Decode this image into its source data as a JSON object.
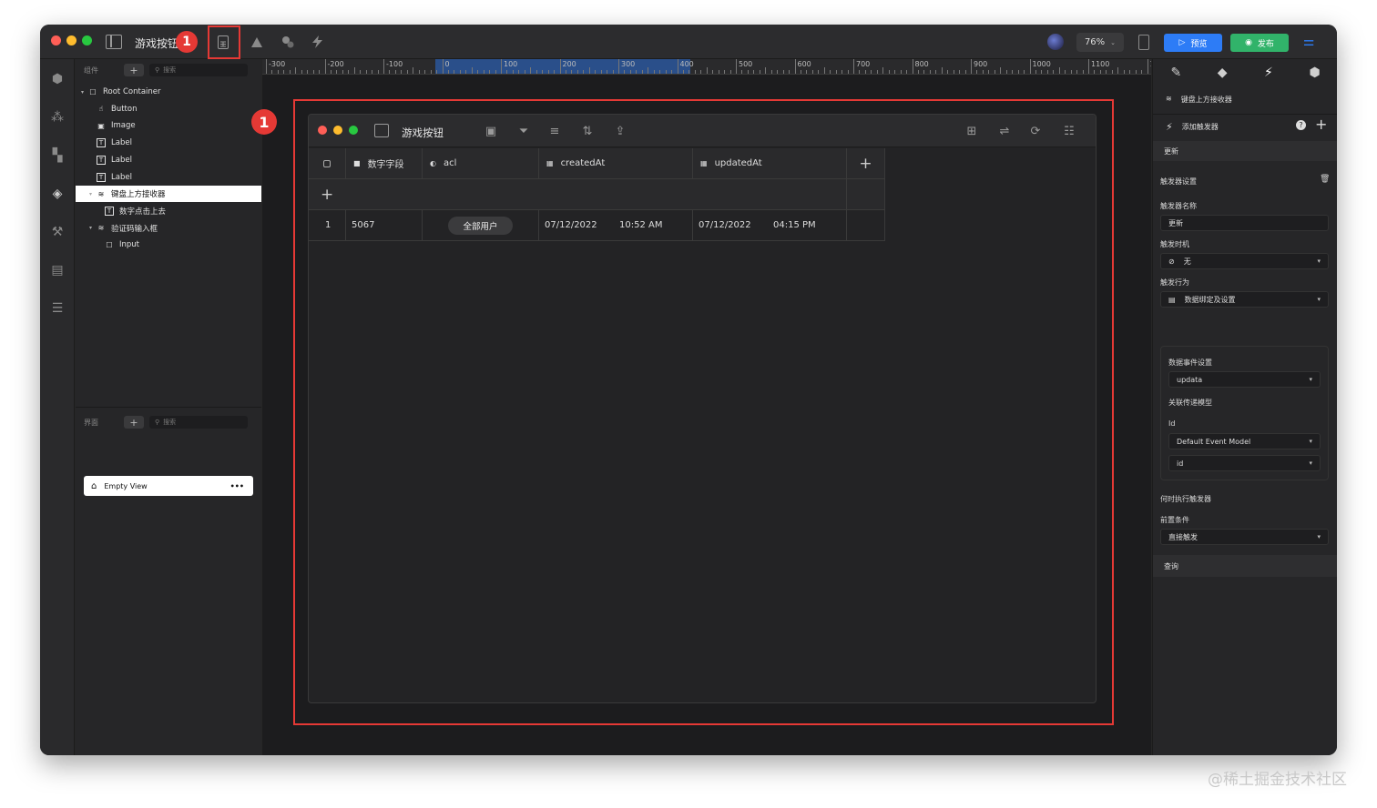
{
  "app": {
    "title": "游戏按钮",
    "zoom": "76%",
    "preview_label": "预览",
    "publish_label": "发布",
    "annotation_number": "1"
  },
  "components_panel": {
    "label": "组件",
    "search_placeholder": "搜索",
    "tree": [
      {
        "label": "Root Container",
        "icon": "square-icon",
        "depth": 0,
        "caret": "▾"
      },
      {
        "label": "Button",
        "icon": "hand-icon",
        "depth": 1,
        "caret": ""
      },
      {
        "label": "Image",
        "icon": "image-icon",
        "depth": 1,
        "caret": ""
      },
      {
        "label": "Label",
        "icon": "text-icon",
        "depth": 1,
        "caret": ""
      },
      {
        "label": "Label",
        "icon": "text-icon",
        "depth": 1,
        "caret": ""
      },
      {
        "label": "Label",
        "icon": "text-icon",
        "depth": 1,
        "caret": ""
      },
      {
        "label": "键盘上方接收器",
        "icon": "database-icon",
        "depth": 1,
        "caret": "▾",
        "selected": true
      },
      {
        "label": "数字点击上去",
        "icon": "text-icon",
        "depth": 2,
        "caret": ""
      },
      {
        "label": "验证码输入框",
        "icon": "database-icon",
        "depth": 1,
        "caret": "▾"
      },
      {
        "label": "Input",
        "icon": "square-icon",
        "depth": 2,
        "caret": ""
      }
    ]
  },
  "views_panel": {
    "label": "界面",
    "search_placeholder": "搜索",
    "item": "Empty View",
    "more": "•••"
  },
  "ruler": {
    "labels": [
      "-300",
      "-200",
      "-100",
      "0",
      "100",
      "200",
      "300",
      "400",
      "500",
      "600",
      "700",
      "800",
      "900",
      "1000",
      "1100",
      "12"
    ]
  },
  "inner_app": {
    "title": "游戏按钮",
    "columns": [
      {
        "label": "",
        "icon": "checkbox-icon"
      },
      {
        "label": "数字字段",
        "icon": "number-icon"
      },
      {
        "label": "acl",
        "icon": "acl-icon"
      },
      {
        "label": "createdAt",
        "icon": "calendar-icon"
      },
      {
        "label": "updatedAt",
        "icon": "calendar-icon"
      }
    ],
    "add_column": "+",
    "add_row": "+",
    "row": {
      "index": "1",
      "number": "5067",
      "acl": "全部用户",
      "created_date": "07/12/2022",
      "created_time": "10:52 AM",
      "updated_date": "07/12/2022",
      "updated_time": "04:15 PM"
    }
  },
  "right_panel": {
    "component_name": "键盘上方接收器",
    "add_trigger": "添加触发器",
    "update_section": "更新",
    "trigger_settings": "触发器设置",
    "trigger_name_label": "触发器名称",
    "trigger_name_value": "更新",
    "trigger_time_label": "触发时机",
    "trigger_time_value": "无",
    "trigger_action_label": "触发行为",
    "trigger_action_value": "数据绑定及设置",
    "data_event_label": "数据事件设置",
    "data_event_value": "updata",
    "relation_model_label": "关联传递模型",
    "id_label": "Id",
    "model_value": "Default Event Model",
    "id_value": "id",
    "when_label": "何时执行触发器",
    "precondition_label": "前置条件",
    "precondition_value": "直接触发",
    "query_section": "查询"
  },
  "watermark": "@稀土掘金技术社区",
  "colors": {
    "accent_blue": "#2d7cf6",
    "publish_green": "#31b36a",
    "annotation_red": "#e53935"
  }
}
